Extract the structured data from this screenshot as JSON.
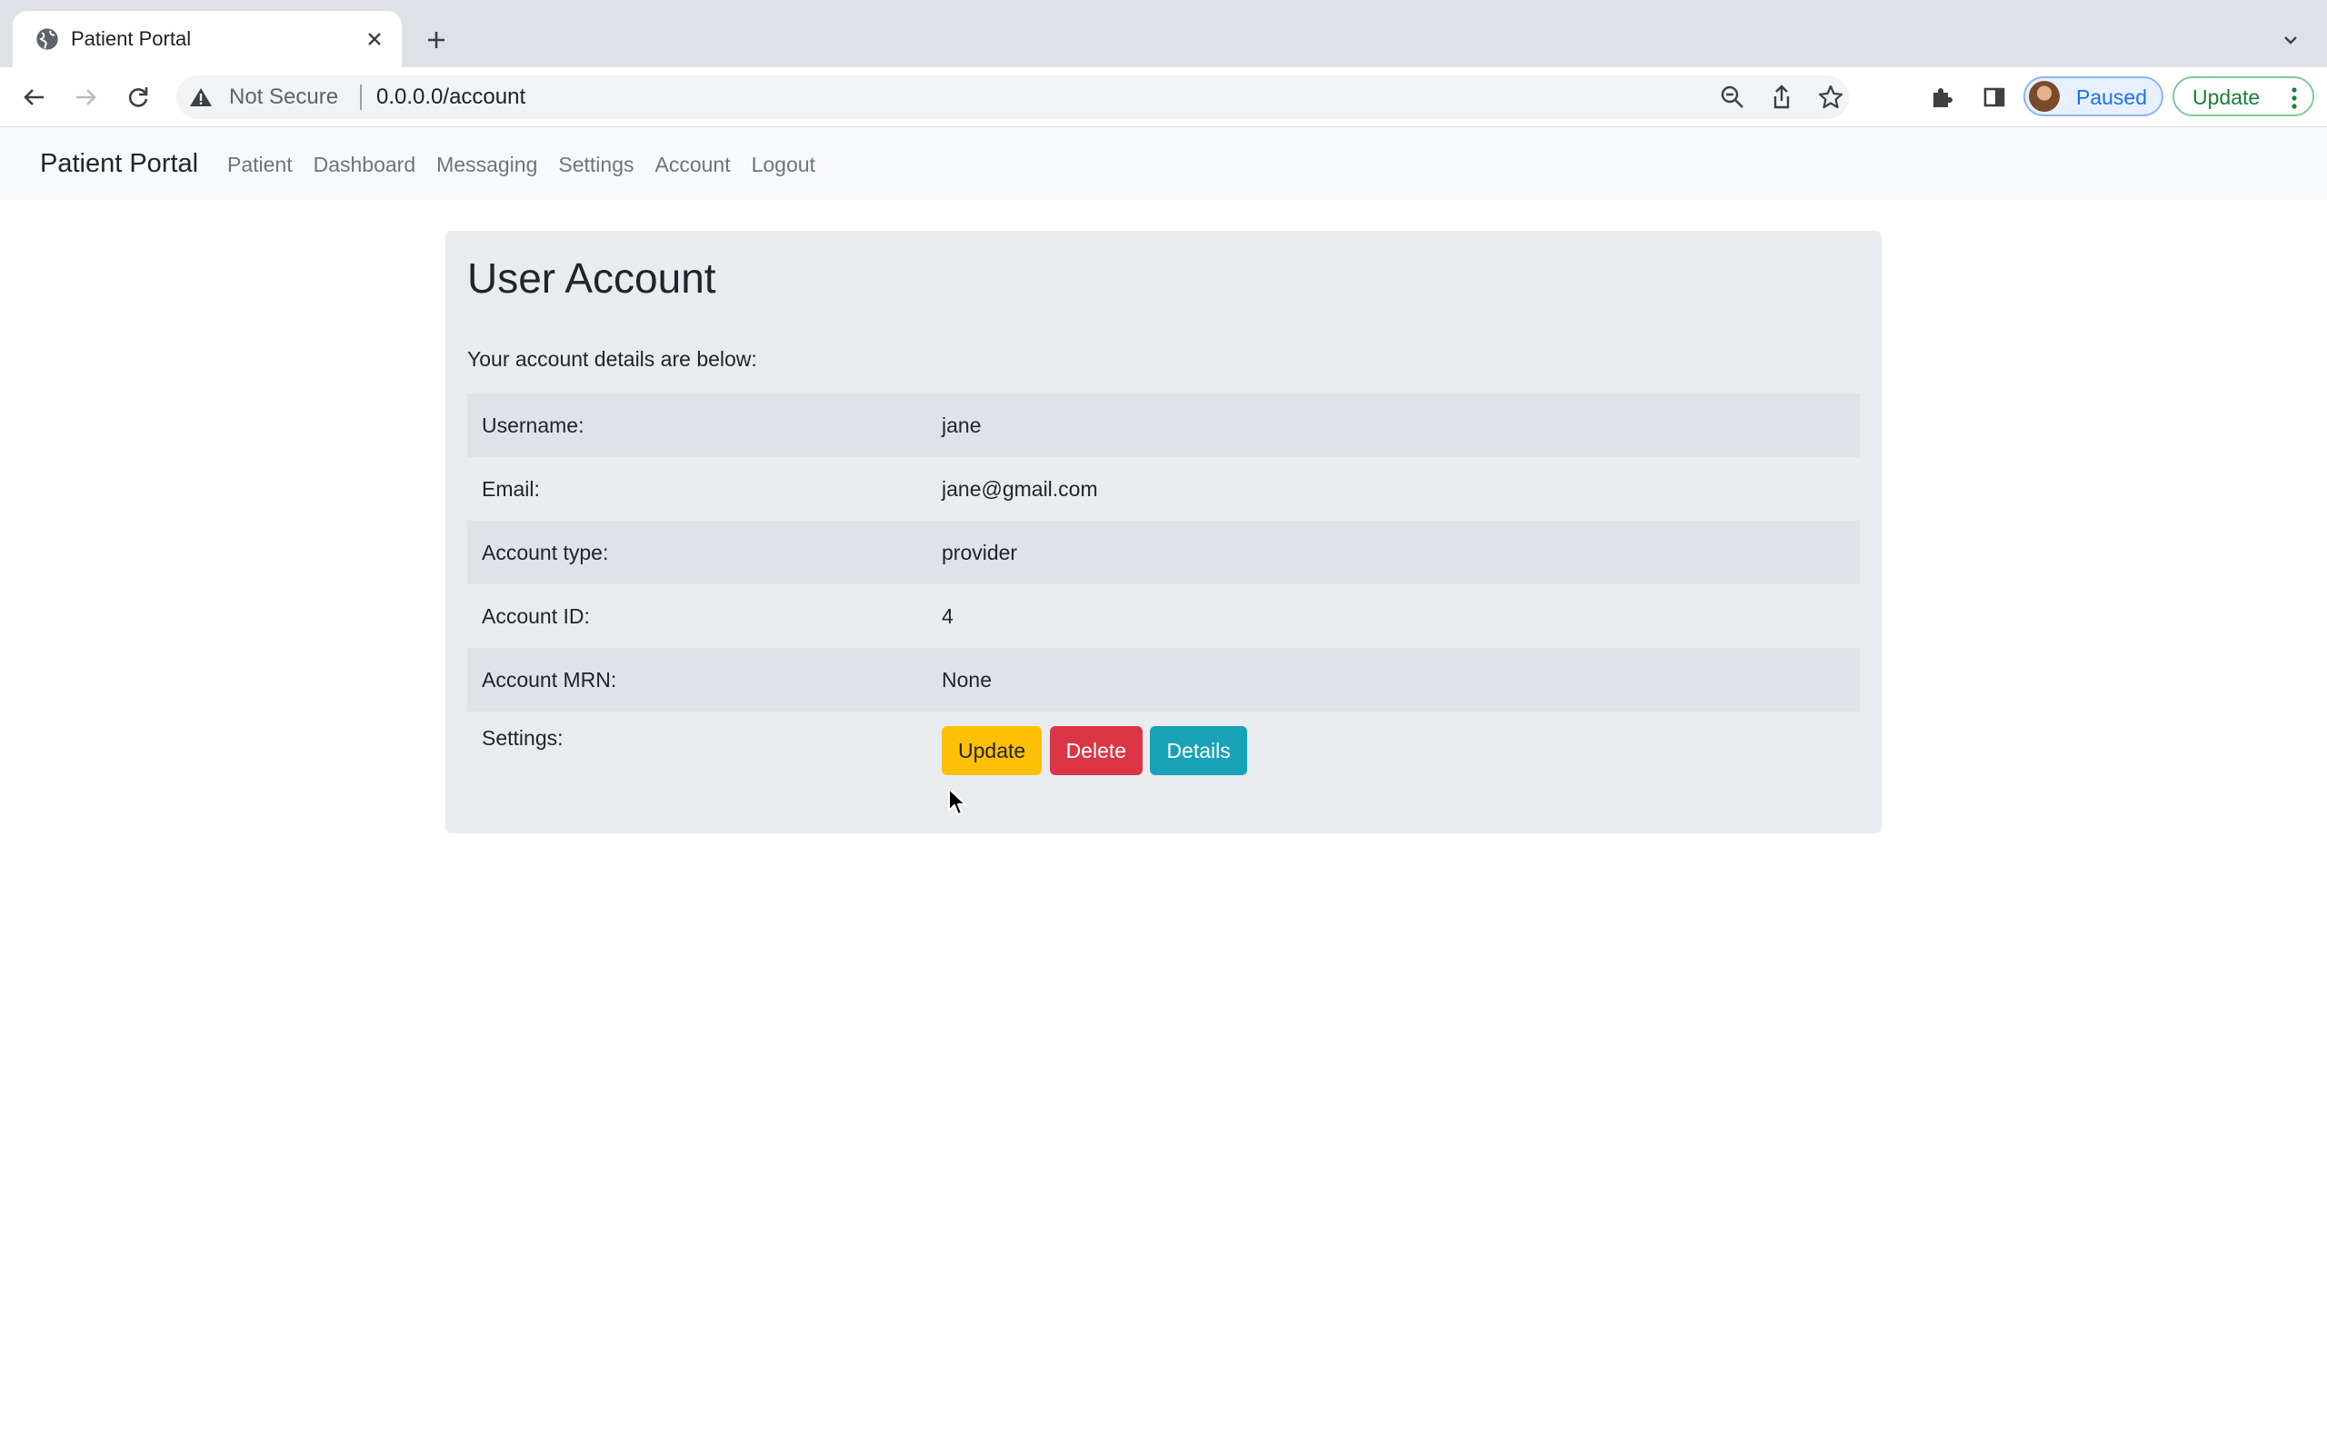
{
  "browser": {
    "tab_title": "Patient Portal",
    "security_label": "Not Secure",
    "url": "0.0.0.0/account",
    "profile_label": "Paused",
    "update_label": "Update"
  },
  "navbar": {
    "brand": "Patient Portal",
    "links": [
      "Patient",
      "Dashboard",
      "Messaging",
      "Settings",
      "Account",
      "Logout"
    ]
  },
  "account": {
    "title": "User Account",
    "intro": "Your account details are below:",
    "rows": [
      {
        "label": "Username:",
        "value": "jane"
      },
      {
        "label": "Email:",
        "value": "jane@gmail.com"
      },
      {
        "label": "Account type:",
        "value": "provider"
      },
      {
        "label": "Account ID:",
        "value": "4"
      },
      {
        "label": "Account MRN:",
        "value": "None"
      }
    ],
    "settings_label": "Settings:",
    "buttons": {
      "update": "Update",
      "delete": "Delete",
      "details": "Details"
    }
  },
  "colors": {
    "warning": "#ffc107",
    "danger": "#dc3545",
    "info": "#17a2b8",
    "card_bg": "#e9ecef",
    "navbar_bg": "#f8f9fa"
  }
}
